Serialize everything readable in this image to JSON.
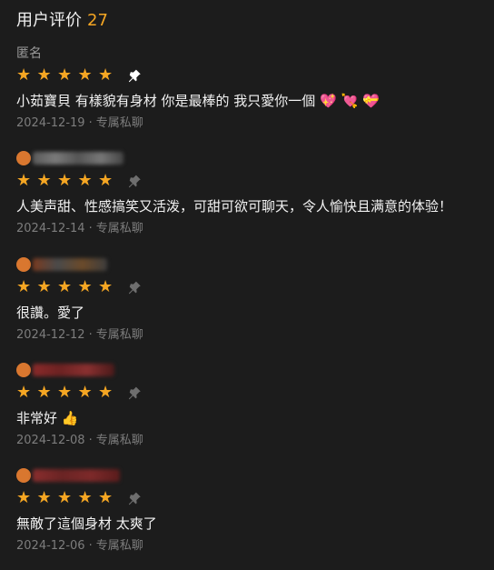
{
  "header": {
    "title": "用户评价",
    "count": "27"
  },
  "reviews": [
    {
      "user": "匿名",
      "stars": 5,
      "pinned": true,
      "comment": "小茹寶貝 有樣貌有身材 你是最棒的 我只愛你一個 💖 💘 💝",
      "date": "2024-12-19",
      "separator": "·",
      "action": "专属私聊"
    },
    {
      "user": "",
      "stars": 5,
      "pinned": false,
      "comment": "人美声甜、性感搞笑又活泼，可甜可欲可聊天，令人愉快且满意的体验！",
      "date": "2024-12-14",
      "separator": "·",
      "action": "专属私聊"
    },
    {
      "user": "",
      "stars": 5,
      "pinned": false,
      "comment": "很讚。愛了",
      "date": "2024-12-12",
      "separator": "·",
      "action": "专属私聊"
    },
    {
      "user": "",
      "stars": 5,
      "pinned": false,
      "comment": "非常好 👍",
      "date": "2024-12-08",
      "separator": "·",
      "action": "专属私聊"
    },
    {
      "user": "",
      "stars": 5,
      "pinned": false,
      "comment": "無敵了這個身材 太爽了",
      "date": "2024-12-06",
      "separator": "·",
      "action": "专属私聊"
    }
  ],
  "colors": {
    "background": "#1c1c1c",
    "accent": "#f5a623",
    "text": "#f2f2f2",
    "muted": "#7d7d7d"
  }
}
